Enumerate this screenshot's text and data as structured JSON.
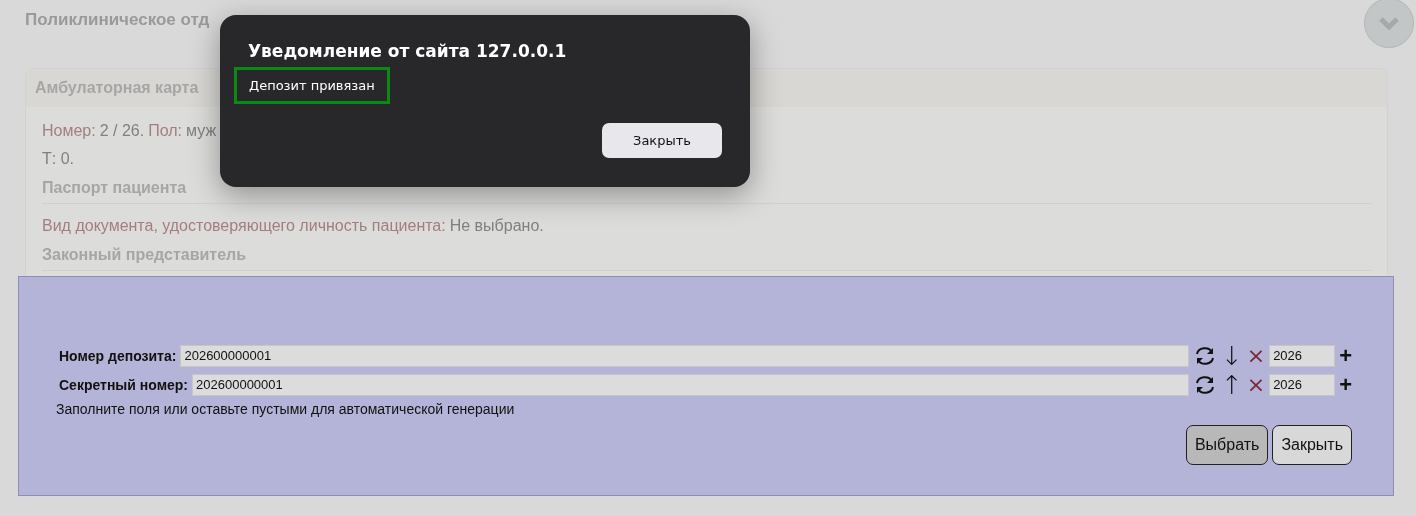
{
  "page": {
    "title": "Поликлиническое отд",
    "card": {
      "title": "Амбулаторная карта",
      "lines": [
        [
          {
            "label": "Номер:",
            "value": "2 / 26."
          },
          {
            "label": "Пол:",
            "value": "муж"
          }
        ],
        [
          {
            "value": "Т: 0."
          }
        ]
      ],
      "sections": [
        {
          "title": "Паспорт пациента",
          "lines": [
            [
              {
                "label": "Вид документа, удостоверяющего личность пациента:",
                "value": "Не выбрано."
              }
            ]
          ]
        },
        {
          "title": "Законный представитель"
        }
      ]
    }
  },
  "panel": {
    "rows": [
      {
        "label": "Номер депозита:",
        "value": "202600000001",
        "arrow": "↓",
        "clear": "×",
        "year": "2026",
        "add": "+"
      },
      {
        "label": "Секретный номер:",
        "value": "202600000001",
        "arrow": "↑",
        "clear": "×",
        "year": "2026",
        "add": "+"
      }
    ],
    "hint": "Заполните поля или оставьте пустыми для автоматической генерации",
    "buttons": [
      {
        "label": "Выбрать",
        "focused": true
      },
      {
        "label": "Закрыть",
        "focused": false
      }
    ]
  },
  "alert": {
    "title": "Уведомление от сайта 127.0.0.1",
    "message": "Депозит привязан",
    "message_focused": true,
    "button": "Закрыть"
  }
}
